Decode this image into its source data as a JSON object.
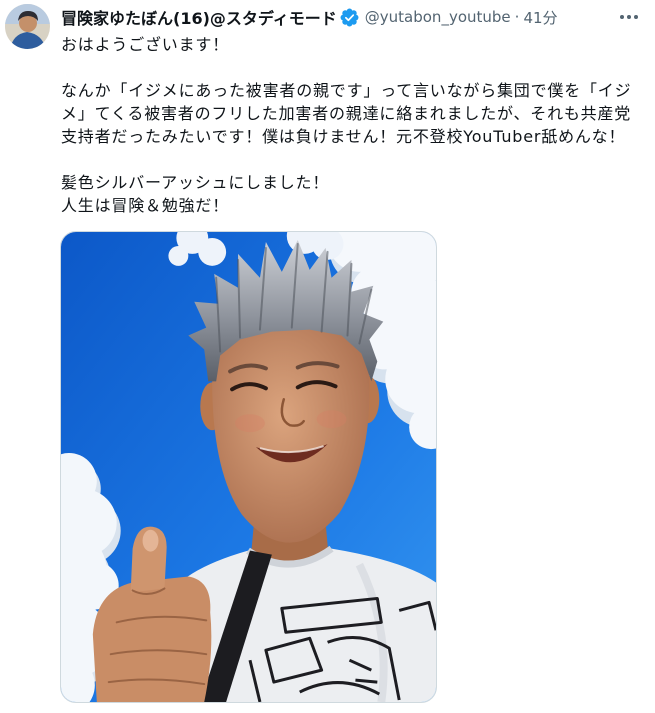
{
  "tweet": {
    "author": {
      "display_name": "冒険家ゆたぼん(16)@スタディモード",
      "verified": true,
      "handle": "@yutabon_youtube",
      "separator": "·",
      "timestamp": "41分"
    },
    "text": {
      "paragraphs": [
        {
          "lines": [
            "おはようございます！"
          ]
        },
        {
          "lines": [
            "なんか「イジメにあった被害者の親です」って言いながら集団で僕を「イジ",
            "メ」てくる被害者のフリした加害者の親達に絡まれましたが、それも共産党",
            "支持者だったみたいです！僕は負けません！元不登校YouTuber舐めんな！"
          ]
        },
        {
          "lines": [
            "髪色シルバーアッシュにしました！",
            "人生は冒険＆勉強だ！"
          ]
        }
      ]
    }
  },
  "icons": {
    "verified": "verified-badge-icon",
    "more": "more-icon"
  },
  "colors": {
    "text": "#0f1419",
    "secondary": "#536471",
    "accent": "#1d9bf0",
    "border": "#cfd9de",
    "background": "#ffffff"
  }
}
